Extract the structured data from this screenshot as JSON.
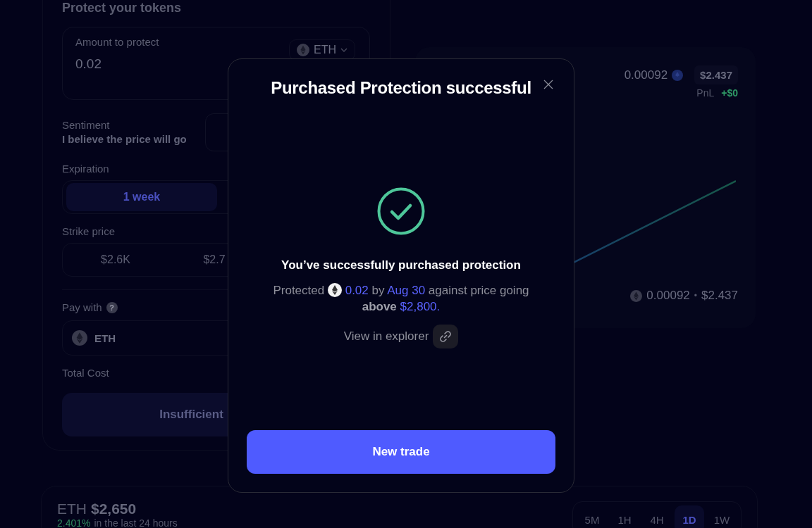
{
  "panel": {
    "title": "Protect your tokens",
    "amount": {
      "label": "Amount to protect",
      "value": "0.02",
      "token": "ETH"
    },
    "sentiment": {
      "label": "Sentiment",
      "text": "I believe the price will go"
    },
    "expiration": {
      "label": "Expiration",
      "options": [
        {
          "label": "1 week",
          "selected": true
        }
      ]
    },
    "strike": {
      "label": "Strike price",
      "options": [
        {
          "label": "$2.6K",
          "selected": false
        },
        {
          "label": "$2.7",
          "selected": false
        }
      ]
    },
    "pay_with": {
      "label": "Pay with",
      "help": "?",
      "token": "ETH"
    },
    "total_cost": {
      "label": "Total Cost"
    },
    "submit": {
      "label": "Insufficient",
      "disabled": true
    }
  },
  "position": {
    "amount": "0.00092",
    "value": "$2.437",
    "pnl_label": "PnL",
    "pnl": "+$0",
    "footer_amount": "0.00092",
    "footer_separator": "•",
    "footer_value": "$2.437"
  },
  "market": {
    "symbol": "ETH",
    "price": "$2,650",
    "change": "2.401%",
    "change_text": "in the last 24 hours",
    "intervals": [
      {
        "label": "5M",
        "selected": false
      },
      {
        "label": "1H",
        "selected": false
      },
      {
        "label": "4H",
        "selected": false
      },
      {
        "label": "1D",
        "selected": true
      },
      {
        "label": "1W",
        "selected": false
      }
    ]
  },
  "modal": {
    "title": "Purchased Protection successful",
    "heading": "You’ve successfully purchased protection",
    "summary": {
      "prefix": "Protected",
      "amount": "0.02",
      "by": "by",
      "date": "Aug 30",
      "middle": "against price going",
      "direction": "above",
      "price": "$2,800."
    },
    "explorer_label": "View in explorer",
    "button": "New trade"
  }
}
